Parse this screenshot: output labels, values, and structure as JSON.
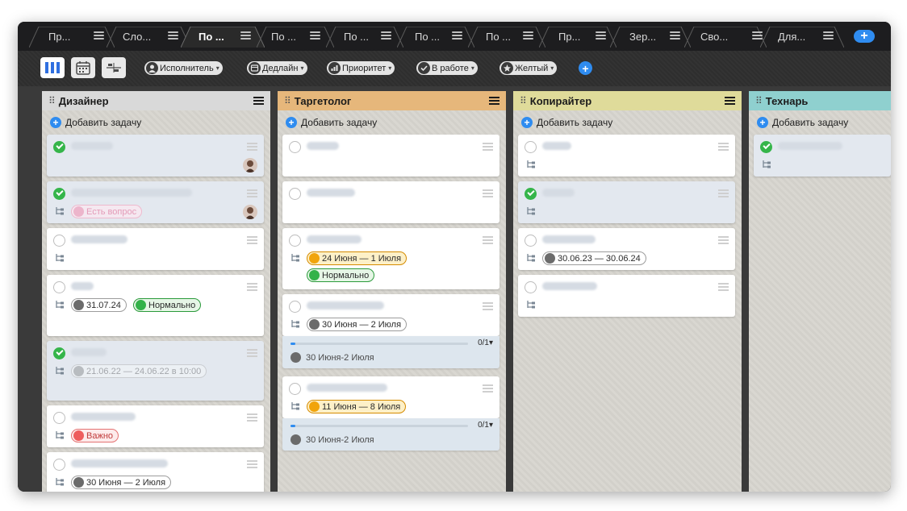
{
  "tabs": [
    {
      "label": "Пр...",
      "active": false
    },
    {
      "label": "Сло...",
      "active": false
    },
    {
      "label": "По ...",
      "active": true
    },
    {
      "label": "По ...",
      "active": false
    },
    {
      "label": "По ...",
      "active": false
    },
    {
      "label": "По ...",
      "active": false
    },
    {
      "label": "По ...",
      "active": false
    },
    {
      "label": "Пр...",
      "active": false
    },
    {
      "label": "Зер...",
      "active": false
    },
    {
      "label": "Сво...",
      "active": false
    },
    {
      "label": "Для...",
      "active": false
    }
  ],
  "tab_add_label": "+",
  "filters": [
    {
      "label": "Исполнитель",
      "icon": "user-icon",
      "caret": "▾"
    },
    {
      "label": "Дедлайн",
      "icon": "calendar-icon",
      "caret": "▾"
    },
    {
      "label": "Приоритет",
      "icon": "bars-icon",
      "caret": "▾"
    },
    {
      "label": "В работе",
      "icon": "check-icon",
      "caret": "▾"
    },
    {
      "label": "Желтый",
      "icon": "star-icon",
      "caret": "▾"
    }
  ],
  "add_filter_label": "+",
  "columns": [
    {
      "title": "Дизайнер",
      "grip": "⠿",
      "color": "#d9d9d9",
      "add_task": "Добавить задачу",
      "plus": "+"
    },
    {
      "title": "Таргетолог",
      "grip": "⠿",
      "color": "#e6b77b",
      "add_task": "Добавить задачу",
      "plus": "+"
    },
    {
      "title": "Копирайтер",
      "grip": "⠿",
      "color": "#dfdb9a",
      "add_task": "Добавить задачу",
      "plus": "+"
    },
    {
      "title": "Технарь",
      "grip": "⠿",
      "color": "#8fd0cf",
      "add_task": "Добавить задачу",
      "plus": "+"
    }
  ],
  "badges": {
    "est_vopros": "Есть вопрос",
    "d_3107": "31.07.24",
    "normalno": "Нормально",
    "d_blur": "21.06.22 — 24.06.22 в 10:00",
    "vazhno": "Важно",
    "d_3006_0207": "30 Июня — 2 Июля",
    "d_2406_0107": "24 Июня — 1 Июля",
    "normalno2": "Нормально",
    "d_3006_0207b": "30 Июня — 2 Июля",
    "d_1106_0807": "11 Июня — 8 Июля",
    "d_300623": "30.06.23 — 30.06.24"
  },
  "subtasks": [
    {
      "count": "0/1▾",
      "date": "30 Июня-2 Июля"
    },
    {
      "count": "0/1▾",
      "date": "30 Июня-2 Июля"
    }
  ],
  "colors": {
    "accent": "#2f8cf0",
    "done_check": "#35b54a"
  }
}
